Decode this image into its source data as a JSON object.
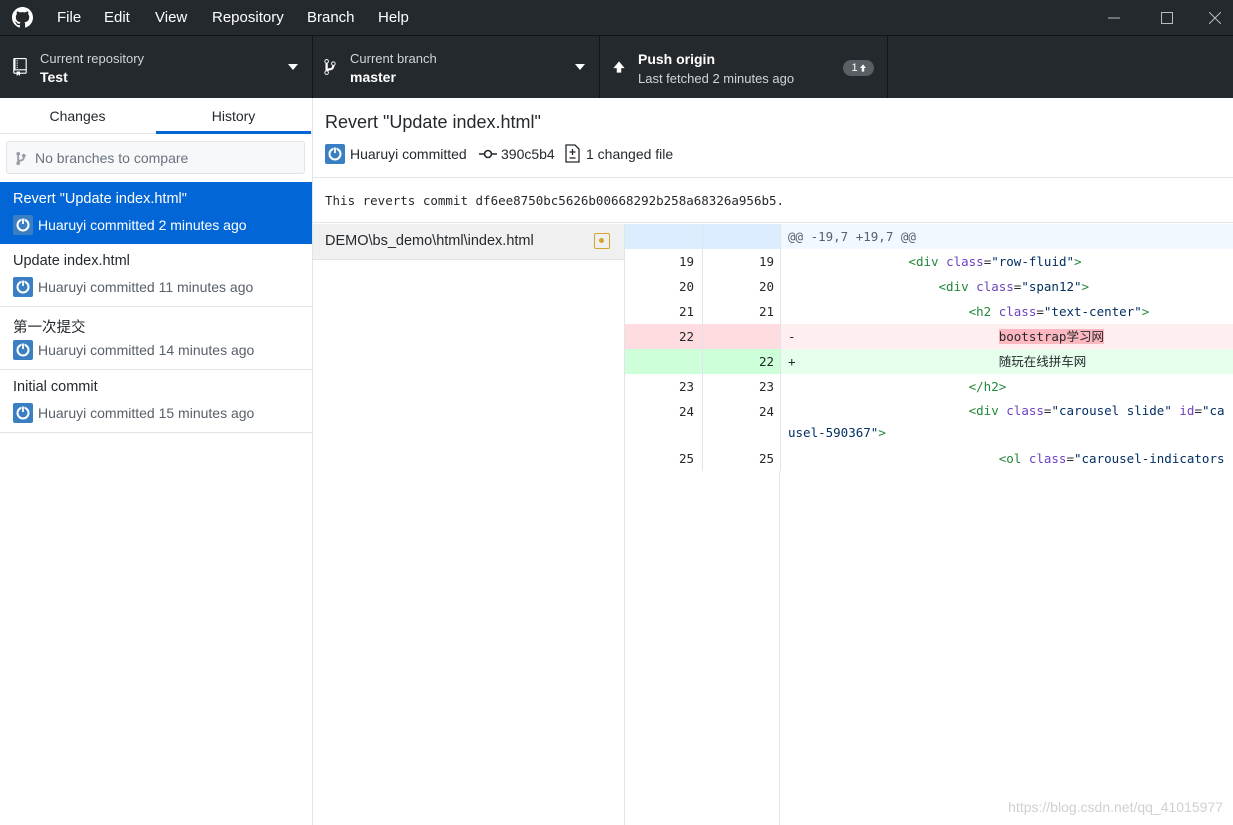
{
  "titlebar": {
    "menus": [
      "File",
      "Edit",
      "View",
      "Repository",
      "Branch",
      "Help"
    ],
    "logo_icon": "github-mark-icon"
  },
  "toolbar": {
    "repo_label": "Current repository",
    "repo_value": "Test",
    "branch_label": "Current branch",
    "branch_value": "master",
    "push_title": "Push origin",
    "push_sub": "Last fetched 2 minutes ago",
    "push_badge": "1"
  },
  "sidebar": {
    "tabs": [
      "Changes",
      "History"
    ],
    "active_tab": "History",
    "compare_placeholder": "No branches to compare",
    "commits": [
      {
        "title": "Revert \"Update index.html\"",
        "meta": "Huaruyi committed 2 minutes ago"
      },
      {
        "title": "Update index.html",
        "meta": "Huaruyi committed 11 minutes ago"
      },
      {
        "title": "第一次提交",
        "meta": "Huaruyi committed 14 minutes ago"
      },
      {
        "title": "Initial commit",
        "meta": "Huaruyi committed 15 minutes ago"
      }
    ]
  },
  "commit": {
    "title": "Revert \"Update index.html\"",
    "author": "Huaruyi committed",
    "sha": "390c5b4",
    "changed": "1 changed file",
    "description": "This reverts commit df6ee8750bc5626b00668292b258a68326a956b5."
  },
  "file": {
    "path": "DEMO\\bs_demo\\html\\index.html"
  },
  "diff": {
    "hunk": "@@ -19,7 +19,7 @@",
    "rows": [
      {
        "old": "19",
        "new": "19"
      },
      {
        "old": "20",
        "new": "20"
      },
      {
        "old": "21",
        "new": "21"
      },
      {
        "old": "22",
        "new": ""
      },
      {
        "old": "",
        "new": "22"
      },
      {
        "old": "23",
        "new": "23"
      },
      {
        "old": "24",
        "new": "24"
      },
      {
        "old": "25",
        "new": "25"
      }
    ],
    "del_text": "bootstrap学习网",
    "add_text": "随玩在线拼车网"
  },
  "watermark": "https://blog.csdn.net/qq_41015977",
  "colors": {
    "accent": "#0366d6",
    "toolbar": "#24292e",
    "add_bg": "#e6ffed",
    "del_bg": "#ffeef0"
  }
}
